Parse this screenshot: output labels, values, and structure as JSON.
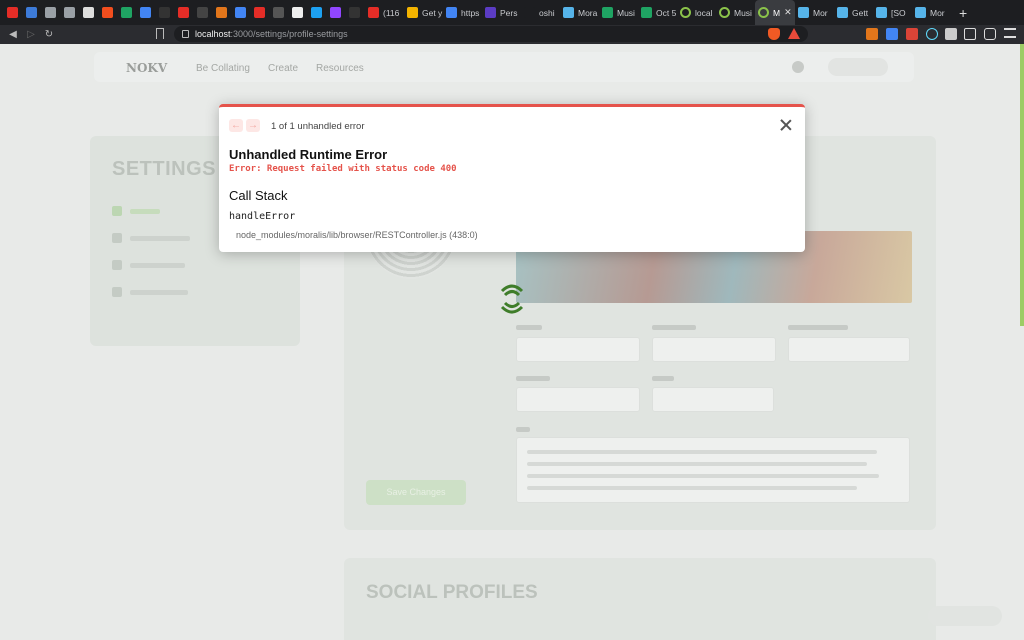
{
  "tabs": [
    {
      "icon": "youtube-icon",
      "color": "#e52d27",
      "label": ""
    },
    {
      "icon": "dropbox-icon",
      "color": "#3d7bd9",
      "label": ""
    },
    {
      "icon": "globe-icon",
      "color": "#9aa0a6",
      "label": ""
    },
    {
      "icon": "globe-icon",
      "color": "#9aa0a6",
      "label": ""
    },
    {
      "icon": "notion-icon",
      "color": "#dddddd",
      "label": ""
    },
    {
      "icon": "figma-icon",
      "color": "#f24e1e",
      "label": ""
    },
    {
      "icon": "sheets-icon",
      "color": "#1fa463",
      "label": ""
    },
    {
      "icon": "docs-icon",
      "color": "#4285f4",
      "label": ""
    },
    {
      "icon": "k-icon",
      "color": "#333333",
      "label": ""
    },
    {
      "icon": "youtube-icon",
      "color": "#e52d27",
      "label": ""
    },
    {
      "icon": "hand-icon",
      "color": "#444444",
      "label": ""
    },
    {
      "icon": "metamask-icon",
      "color": "#e2761b",
      "label": ""
    },
    {
      "icon": "docs-icon",
      "color": "#4285f4",
      "label": ""
    },
    {
      "icon": "youtube-icon",
      "color": "#e52d27",
      "label": ""
    },
    {
      "icon": "circle-icon",
      "color": "#555555",
      "label": ""
    },
    {
      "icon": "github-icon",
      "color": "#eeeeee",
      "label": ""
    },
    {
      "icon": "twitter-icon",
      "color": "#1da1f2",
      "label": ""
    },
    {
      "icon": "twitch-icon",
      "color": "#9146ff",
      "label": ""
    },
    {
      "icon": "k-icon",
      "color": "#333333",
      "label": ""
    },
    {
      "icon": "youtube-icon",
      "color": "#e52d27",
      "label": "(116"
    },
    {
      "icon": "star-icon",
      "color": "#f4b400",
      "label": "Get y"
    },
    {
      "icon": "file-icon",
      "color": "#4285f4",
      "label": "https"
    },
    {
      "icon": "p-icon",
      "color": "#5b3cc4",
      "label": "Pers"
    },
    {
      "icon": "blank-icon",
      "color": "#1d1e21",
      "label": "oshi"
    },
    {
      "icon": "moralis-icon",
      "color": "#56b4e9",
      "label": "Mora"
    },
    {
      "icon": "sheets-icon",
      "color": "#1fa463",
      "label": "Musi"
    },
    {
      "icon": "sheets-icon",
      "color": "#1fa463",
      "label": "Oct 5"
    },
    {
      "icon": "ring-icon",
      "color": "#8bc34a",
      "label": "local"
    },
    {
      "icon": "ring-icon",
      "color": "#8bc34a",
      "label": "Musi"
    },
    {
      "icon": "ring-icon",
      "color": "#8bc34a",
      "label": "M",
      "active": true
    },
    {
      "icon": "moralis-icon",
      "color": "#56b4e9",
      "label": "Mor"
    },
    {
      "icon": "moralis-icon",
      "color": "#56b4e9",
      "label": "Gett"
    },
    {
      "icon": "moralis-icon",
      "color": "#56b4e9",
      "label": "[SO"
    },
    {
      "icon": "moralis-icon",
      "color": "#56b4e9",
      "label": "Mor"
    }
  ],
  "browser": {
    "url_host": "localhost",
    "url_rest": ":3000/settings/profile-settings",
    "new_tab": "+",
    "tab_close": "✕",
    "back": "◀",
    "forward": "▷",
    "reload": "↻"
  },
  "colors": {
    "error_accent": "#e5534b",
    "brand_green": "#9ccc65"
  },
  "error_overlay": {
    "prev_arrow": "←",
    "next_arrow": "→",
    "count_text": "1 of 1 unhandled error",
    "title": "Unhandled Runtime Error",
    "message": "Error: Request failed with status code 400",
    "stack_title": "Call Stack",
    "frame_function": "handleError",
    "frame_location": "node_modules/moralis/lib/browser/RESTController.js (438:0)"
  }
}
